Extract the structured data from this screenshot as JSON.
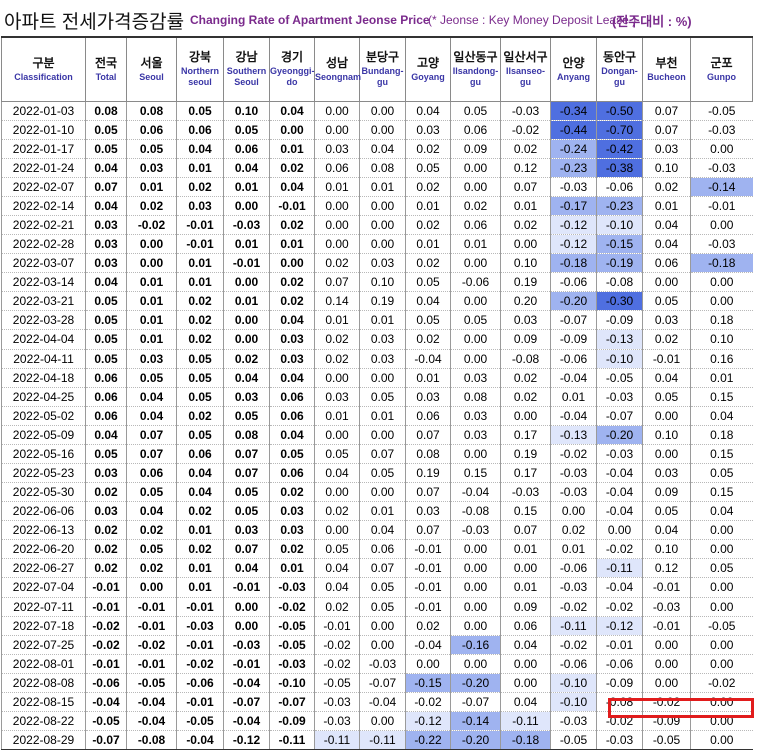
{
  "title": {
    "ko": "아파트 전세가격증감률",
    "en": "Changing Rate of Apartment Jeonse Price",
    "note": "(* Jeonse : Key Money Deposit Lease )",
    "unit": "(전주대비 : %)"
  },
  "colors": {
    "purple_text": "#7a2a8c",
    "english_header": "#3a36a6",
    "blue_shade_light": "#dfe6fb",
    "blue_shade_mid": "#9fb3f0",
    "blue_shade_dark": "#4f6fe0",
    "highlight_border": "#e11c1c"
  },
  "columns": [
    {
      "ko": "구분",
      "en": "Classification"
    },
    {
      "ko": "전국",
      "en": "Total",
      "bold": true
    },
    {
      "ko": "서울",
      "en": "Seoul",
      "bold": true
    },
    {
      "ko": "강북",
      "en": "Northern seoul",
      "bold": true
    },
    {
      "ko": "강남",
      "en": "Southern Seoul",
      "bold": true
    },
    {
      "ko": "경기",
      "en": "Gyeonggi-do",
      "bold": true
    },
    {
      "ko": "성남",
      "en": "Seongnam"
    },
    {
      "ko": "분당구",
      "en": "Bundang-gu"
    },
    {
      "ko": "고양",
      "en": "Goyang"
    },
    {
      "ko": "일산동구",
      "en": "Ilsandong-gu"
    },
    {
      "ko": "일산서구",
      "en": "Ilsanseo-gu"
    },
    {
      "ko": "안양",
      "en": "Anyang"
    },
    {
      "ko": "동안구",
      "en": "Dongan-gu"
    },
    {
      "ko": "부천",
      "en": "Bucheon"
    },
    {
      "ko": "군포",
      "en": "Gunpo"
    }
  ],
  "rows": [
    {
      "date": "2022-01-03",
      "values": [
        "0.08",
        "0.08",
        "0.05",
        "0.10",
        "0.04",
        "0.00",
        "0.00",
        "0.04",
        "0.05",
        "-0.03",
        "-0.34",
        "-0.50",
        "0.07",
        "-0.05"
      ]
    },
    {
      "date": "2022-01-10",
      "values": [
        "0.05",
        "0.06",
        "0.06",
        "0.05",
        "0.00",
        "0.00",
        "0.00",
        "0.03",
        "0.06",
        "-0.02",
        "-0.44",
        "-0.70",
        "0.07",
        "-0.03"
      ]
    },
    {
      "date": "2022-01-17",
      "values": [
        "0.05",
        "0.05",
        "0.04",
        "0.06",
        "0.01",
        "0.03",
        "0.04",
        "0.02",
        "0.09",
        "0.02",
        "-0.24",
        "-0.42",
        "0.03",
        "0.00"
      ]
    },
    {
      "date": "2022-01-24",
      "values": [
        "0.04",
        "0.03",
        "0.01",
        "0.04",
        "0.02",
        "0.06",
        "0.08",
        "0.05",
        "0.00",
        "0.12",
        "-0.23",
        "-0.38",
        "0.10",
        "-0.03"
      ]
    },
    {
      "date": "2022-02-07",
      "values": [
        "0.07",
        "0.01",
        "0.02",
        "0.01",
        "0.04",
        "0.01",
        "0.01",
        "0.02",
        "0.00",
        "0.07",
        "-0.03",
        "-0.06",
        "0.02",
        "-0.14"
      ]
    },
    {
      "date": "2022-02-14",
      "values": [
        "0.04",
        "0.02",
        "0.03",
        "0.00",
        "-0.01",
        "0.00",
        "0.00",
        "0.01",
        "0.02",
        "0.01",
        "-0.17",
        "-0.23",
        "0.01",
        "-0.01"
      ]
    },
    {
      "date": "2022-02-21",
      "values": [
        "0.03",
        "-0.02",
        "-0.01",
        "-0.03",
        "0.02",
        "0.00",
        "0.00",
        "0.02",
        "0.06",
        "0.02",
        "-0.12",
        "-0.10",
        "0.04",
        "0.00"
      ]
    },
    {
      "date": "2022-02-28",
      "values": [
        "0.03",
        "0.00",
        "-0.01",
        "0.01",
        "0.01",
        "0.00",
        "0.00",
        "0.01",
        "0.01",
        "0.00",
        "-0.12",
        "-0.15",
        "0.04",
        "-0.03"
      ]
    },
    {
      "date": "2022-03-07",
      "values": [
        "0.03",
        "0.00",
        "0.01",
        "-0.01",
        "0.00",
        "0.02",
        "0.03",
        "0.02",
        "0.00",
        "0.10",
        "-0.18",
        "-0.19",
        "0.06",
        "-0.18"
      ]
    },
    {
      "date": "2022-03-14",
      "values": [
        "0.04",
        "0.01",
        "0.01",
        "0.00",
        "0.02",
        "0.07",
        "0.10",
        "0.05",
        "-0.06",
        "0.19",
        "-0.06",
        "-0.08",
        "0.00",
        "0.00"
      ]
    },
    {
      "date": "2022-03-21",
      "values": [
        "0.05",
        "0.01",
        "0.02",
        "0.01",
        "0.02",
        "0.14",
        "0.19",
        "0.04",
        "0.00",
        "0.20",
        "-0.20",
        "-0.30",
        "0.05",
        "0.00"
      ]
    },
    {
      "date": "2022-03-28",
      "values": [
        "0.05",
        "0.01",
        "0.02",
        "0.00",
        "0.04",
        "0.01",
        "0.01",
        "0.05",
        "0.05",
        "0.03",
        "-0.07",
        "-0.09",
        "0.03",
        "0.18"
      ]
    },
    {
      "date": "2022-04-04",
      "values": [
        "0.05",
        "0.01",
        "0.02",
        "0.00",
        "0.03",
        "0.02",
        "0.03",
        "0.02",
        "0.00",
        "0.09",
        "-0.09",
        "-0.13",
        "0.02",
        "0.10"
      ]
    },
    {
      "date": "2022-04-11",
      "values": [
        "0.05",
        "0.03",
        "0.05",
        "0.02",
        "0.03",
        "0.02",
        "0.03",
        "-0.04",
        "0.00",
        "-0.08",
        "-0.06",
        "-0.10",
        "-0.01",
        "0.16"
      ]
    },
    {
      "date": "2022-04-18",
      "values": [
        "0.06",
        "0.05",
        "0.05",
        "0.04",
        "0.04",
        "0.00",
        "0.00",
        "0.01",
        "0.03",
        "0.02",
        "-0.04",
        "-0.05",
        "0.04",
        "0.01"
      ]
    },
    {
      "date": "2022-04-25",
      "values": [
        "0.06",
        "0.04",
        "0.05",
        "0.03",
        "0.06",
        "0.03",
        "0.05",
        "0.03",
        "0.08",
        "0.02",
        "0.01",
        "-0.03",
        "0.05",
        "0.15"
      ]
    },
    {
      "date": "2022-05-02",
      "values": [
        "0.06",
        "0.04",
        "0.02",
        "0.05",
        "0.06",
        "0.01",
        "0.01",
        "0.06",
        "0.03",
        "0.00",
        "-0.04",
        "-0.07",
        "0.00",
        "0.04"
      ]
    },
    {
      "date": "2022-05-09",
      "values": [
        "0.04",
        "0.07",
        "0.05",
        "0.08",
        "0.04",
        "0.00",
        "0.00",
        "0.07",
        "0.03",
        "0.17",
        "-0.13",
        "-0.20",
        "0.10",
        "0.18"
      ]
    },
    {
      "date": "2022-05-16",
      "values": [
        "0.05",
        "0.07",
        "0.06",
        "0.07",
        "0.05",
        "0.05",
        "0.07",
        "0.08",
        "0.00",
        "0.19",
        "-0.02",
        "-0.03",
        "0.00",
        "0.15"
      ]
    },
    {
      "date": "2022-05-23",
      "values": [
        "0.03",
        "0.06",
        "0.04",
        "0.07",
        "0.06",
        "0.04",
        "0.05",
        "0.19",
        "0.15",
        "0.17",
        "-0.03",
        "-0.04",
        "0.03",
        "0.05"
      ]
    },
    {
      "date": "2022-05-30",
      "values": [
        "0.02",
        "0.05",
        "0.04",
        "0.05",
        "0.02",
        "0.00",
        "0.00",
        "0.07",
        "-0.04",
        "-0.03",
        "-0.03",
        "-0.04",
        "0.09",
        "0.15"
      ]
    },
    {
      "date": "2022-06-06",
      "values": [
        "0.03",
        "0.04",
        "0.02",
        "0.05",
        "0.03",
        "0.02",
        "0.01",
        "0.03",
        "-0.08",
        "0.15",
        "0.00",
        "-0.04",
        "0.05",
        "0.04"
      ]
    },
    {
      "date": "2022-06-13",
      "values": [
        "0.02",
        "0.02",
        "0.01",
        "0.03",
        "0.03",
        "0.00",
        "0.04",
        "0.07",
        "-0.03",
        "0.07",
        "0.02",
        "0.00",
        "0.04",
        "0.00"
      ]
    },
    {
      "date": "2022-06-20",
      "values": [
        "0.02",
        "0.05",
        "0.02",
        "0.07",
        "0.02",
        "0.05",
        "0.06",
        "-0.01",
        "0.00",
        "0.01",
        "0.01",
        "-0.02",
        "0.10",
        "0.00"
      ]
    },
    {
      "date": "2022-06-27",
      "values": [
        "0.02",
        "0.02",
        "0.01",
        "0.04",
        "0.01",
        "0.04",
        "0.07",
        "-0.01",
        "0.00",
        "0.00",
        "-0.06",
        "-0.11",
        "0.12",
        "0.05"
      ]
    },
    {
      "date": "2022-07-04",
      "values": [
        "-0.01",
        "0.00",
        "0.01",
        "-0.01",
        "-0.03",
        "0.04",
        "0.05",
        "-0.01",
        "0.00",
        "0.01",
        "-0.03",
        "-0.04",
        "-0.01",
        "0.00"
      ]
    },
    {
      "date": "2022-07-11",
      "values": [
        "-0.01",
        "-0.01",
        "-0.01",
        "0.00",
        "-0.02",
        "0.02",
        "0.05",
        "-0.01",
        "0.00",
        "0.09",
        "-0.02",
        "-0.02",
        "-0.03",
        "0.00"
      ]
    },
    {
      "date": "2022-07-18",
      "values": [
        "-0.02",
        "-0.01",
        "-0.03",
        "0.00",
        "-0.05",
        "-0.01",
        "0.00",
        "0.02",
        "0.00",
        "0.06",
        "-0.11",
        "-0.12",
        "-0.01",
        "-0.05"
      ]
    },
    {
      "date": "2022-07-25",
      "values": [
        "-0.02",
        "-0.02",
        "-0.01",
        "-0.03",
        "-0.05",
        "-0.02",
        "0.00",
        "-0.04",
        "-0.16",
        "0.04",
        "-0.02",
        "-0.01",
        "0.00",
        "0.00"
      ]
    },
    {
      "date": "2022-08-01",
      "values": [
        "-0.01",
        "-0.01",
        "-0.02",
        "-0.01",
        "-0.03",
        "-0.02",
        "-0.03",
        "0.00",
        "0.00",
        "0.00",
        "-0.06",
        "-0.06",
        "0.00",
        "0.00"
      ]
    },
    {
      "date": "2022-08-08",
      "values": [
        "-0.06",
        "-0.05",
        "-0.06",
        "-0.04",
        "-0.10",
        "-0.05",
        "-0.07",
        "-0.15",
        "-0.20",
        "0.00",
        "-0.10",
        "-0.09",
        "0.00",
        "-0.02"
      ]
    },
    {
      "date": "2022-08-15",
      "values": [
        "-0.04",
        "-0.04",
        "-0.01",
        "-0.07",
        "-0.07",
        "-0.03",
        "-0.04",
        "-0.02",
        "-0.07",
        "0.04",
        "-0.10",
        "-0.08",
        "-0.02",
        "0.00"
      ]
    },
    {
      "date": "2022-08-22",
      "values": [
        "-0.05",
        "-0.04",
        "-0.05",
        "-0.04",
        "-0.09",
        "-0.03",
        "0.00",
        "-0.12",
        "-0.14",
        "-0.11",
        "-0.03",
        "-0.02",
        "-0.09",
        "0.00"
      ]
    },
    {
      "date": "2022-08-29",
      "values": [
        "-0.07",
        "-0.08",
        "-0.04",
        "-0.12",
        "-0.11",
        "-0.11",
        "-0.11",
        "-0.22",
        "-0.20",
        "-0.18",
        "-0.05",
        "-0.03",
        "-0.05",
        "0.00"
      ]
    }
  ]
}
